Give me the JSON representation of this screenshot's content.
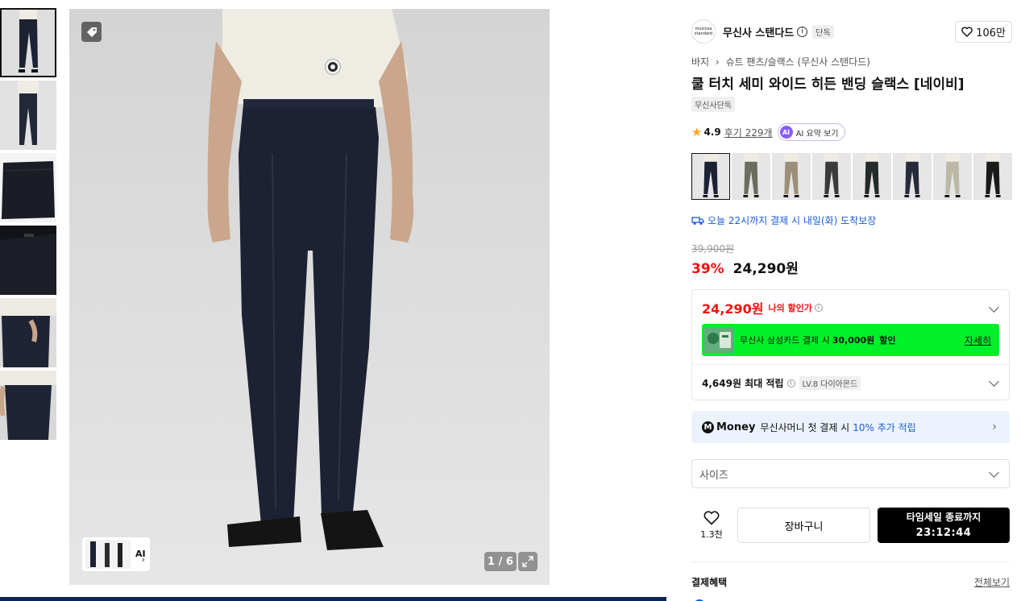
{
  "gallery": {
    "thumbnail_count": 6,
    "active_thumbnail": 1,
    "ai_label": "AI",
    "counter": "1 / 6"
  },
  "brand": {
    "logo_text": "musinsa standard",
    "name": "무신사 스탠다드",
    "exclusive_badge": "단독",
    "like_count": "106만"
  },
  "breadcrumb": [
    "바지",
    "슈트 팬츠/슬랙스 (무신사 스탠다드)"
  ],
  "product": {
    "title": "쿨 터치 세미 와이드 히든 밴딩 슬랙스 [네이비]",
    "exclusive_tag": "무신사단독",
    "rating": "4.9",
    "reviews": "후기 229개",
    "ai_summary": "AI 요약 보기"
  },
  "colors": [
    {
      "name": "navy",
      "hex": "#1c2233"
    },
    {
      "name": "olive",
      "hex": "#6b6e5e"
    },
    {
      "name": "beige",
      "hex": "#9c8f7a"
    },
    {
      "name": "charcoal",
      "hex": "#3b3b3d"
    },
    {
      "name": "black-green",
      "hex": "#232a2a"
    },
    {
      "name": "dark-navy",
      "hex": "#252b3a"
    },
    {
      "name": "light-beige",
      "hex": "#bdb8a6"
    },
    {
      "name": "black",
      "hex": "#1a1a1a"
    }
  ],
  "delivery": "오늘 22시까지 결제 시 내일(화) 도착보장",
  "price": {
    "original": "39,900원",
    "discount_rate": "39%",
    "sale": "24,290원"
  },
  "benefits": {
    "my_price": "24,290원",
    "my_price_label": "나의 할인가",
    "card_text_pre": "무신사 삼성카드 결제 시",
    "card_amount": "30,000원",
    "card_text_post": "할인",
    "card_detail": "자세히",
    "points": "4,649원 최대 적립",
    "level_badge": "LV.8 다이아몬드"
  },
  "money": {
    "brand": "Money",
    "text": "무신사머니 첫 결제 시",
    "highlight": "10% 추가 적립"
  },
  "size_placeholder": "사이즈",
  "actions": {
    "wish_count": "1.3천",
    "cart": "장바구니",
    "buy_line1": "타임세일 종료까지",
    "buy_line2": "23:12:44"
  },
  "payment": {
    "title": "결제혜택",
    "view_all": "전체보기"
  },
  "theme": {
    "accent_red": "#f31110",
    "accent_blue": "#1a5bd8",
    "card_green": "#00f028"
  }
}
